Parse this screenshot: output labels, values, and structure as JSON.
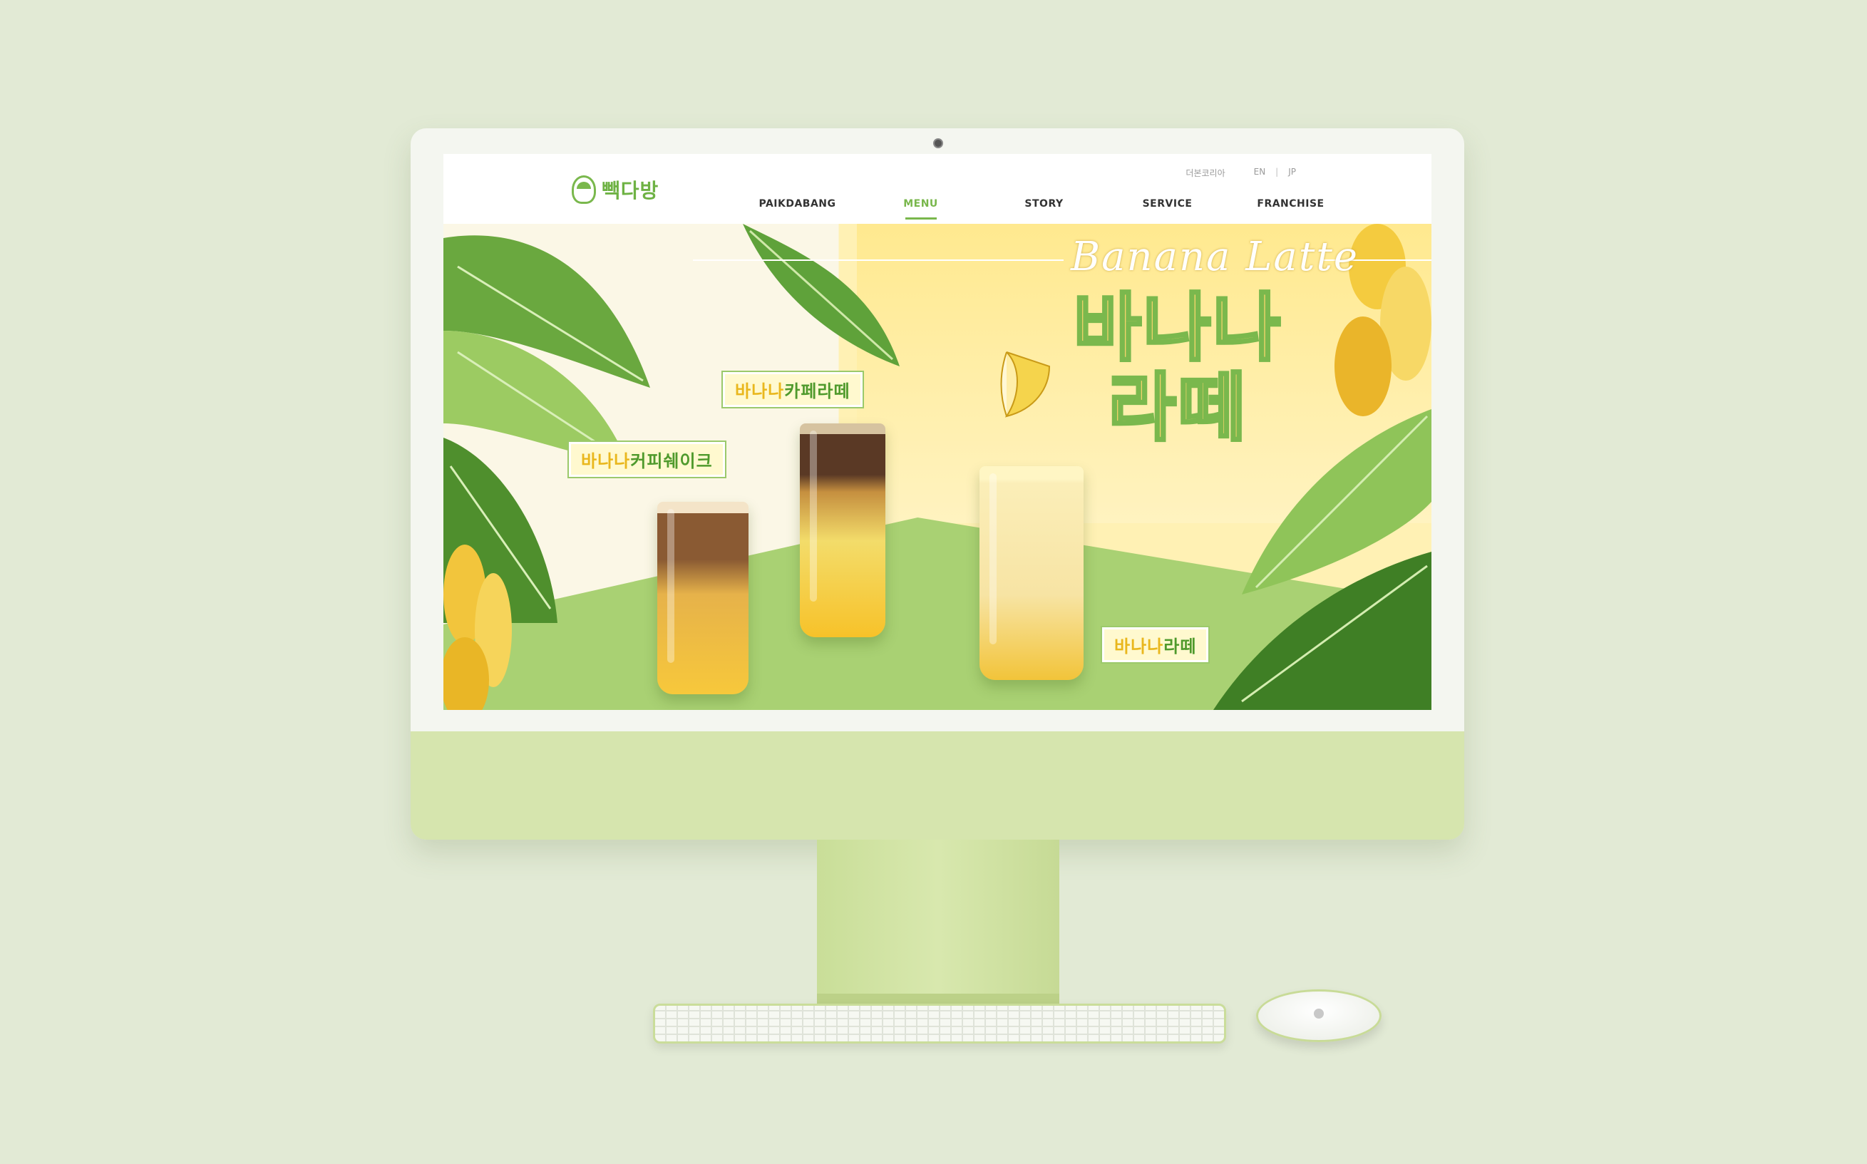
{
  "header": {
    "logo_text": "빽다방",
    "util_links": [
      "더본코리아",
      "EN",
      "JP"
    ],
    "nav": [
      {
        "label": "PAIKDABANG",
        "active": false
      },
      {
        "label": "MENU",
        "active": true
      },
      {
        "label": "STORY",
        "active": false
      },
      {
        "label": "SERVICE",
        "active": false
      },
      {
        "label": "FRANCHISE",
        "active": false
      }
    ]
  },
  "banner": {
    "script_title": "Banana Latte",
    "headline_line1": "바나나",
    "headline_line2": "라떼",
    "products": [
      {
        "prefix": "바나나",
        "suffix": "커피쉐이크"
      },
      {
        "prefix": "바나나",
        "suffix": "카페라떼"
      },
      {
        "prefix": "바나나",
        "suffix": "라떼"
      }
    ]
  },
  "colors": {
    "accent_green": "#79b74c",
    "banana_yellow": "#f4d46a",
    "device_green": "#d6e5ae"
  }
}
